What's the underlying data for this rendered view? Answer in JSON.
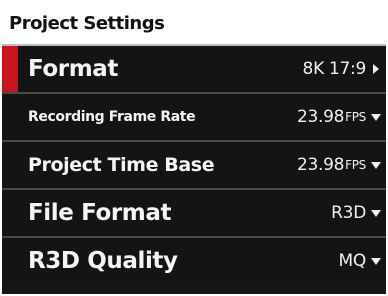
{
  "panel": {
    "title": "Project Settings"
  },
  "rows": [
    {
      "label": "Format",
      "value": "8K 17:9",
      "unit": "",
      "icon": "chevron-right-icon",
      "selected": true
    },
    {
      "label": "Recording Frame Rate",
      "value": "23.98",
      "unit": "FPS",
      "icon": "caret-down-icon",
      "selected": false
    },
    {
      "label": "Project Time Base",
      "value": "23.98",
      "unit": "FPS",
      "icon": "caret-down-icon",
      "selected": false
    },
    {
      "label": "File Format",
      "value": "R3D",
      "unit": "",
      "icon": "caret-down-icon",
      "selected": false
    },
    {
      "label": "R3D Quality",
      "value": "MQ",
      "unit": "",
      "icon": "caret-down-icon",
      "selected": false
    }
  ],
  "colors": {
    "accent": "#c8141c",
    "row_background": "#141414",
    "divider": "#4a4a4a",
    "text": "#f4f4f4"
  }
}
